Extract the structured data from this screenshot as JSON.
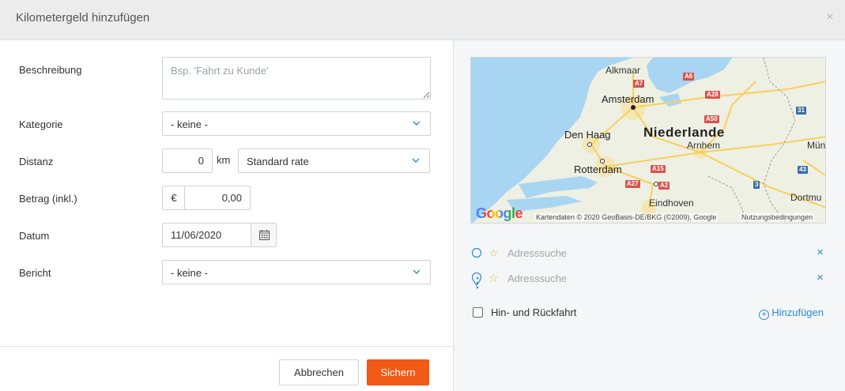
{
  "header": {
    "title": "Kilometergeld hinzufügen",
    "close_symbol": "×"
  },
  "form": {
    "description": {
      "label": "Beschreibung",
      "placeholder": "Bsp. 'Fahrt zu Kunde'",
      "value": ""
    },
    "category": {
      "label": "Kategorie",
      "value": "- keine -"
    },
    "distance": {
      "label": "Distanz",
      "value": "0",
      "unit": "km",
      "rate": "Standard rate"
    },
    "amount": {
      "label": "Betrag (inkl.)",
      "currency": "€",
      "value": "0,00"
    },
    "date": {
      "label": "Datum",
      "value": "11/06/2020"
    },
    "report": {
      "label": "Bericht",
      "value": "- keine -"
    }
  },
  "footer": {
    "cancel_label": "Abbrechen",
    "save_label": "Sichern"
  },
  "map": {
    "cities": {
      "alkmaar": "Alkmaar",
      "amsterdam": "Amsterdam",
      "den_haag": "Den Haag",
      "rotterdam": "Rotterdam",
      "arnhem": "Arnhem",
      "eindhoven": "Eindhoven",
      "munster": "Mün",
      "dortmund": "Dortmu"
    },
    "country": "Niederlande",
    "roads": {
      "a7": "A7",
      "a6": "A6",
      "a28": "A28",
      "a50": "A50",
      "a15": "A15",
      "a27": "A27",
      "a2": "A2",
      "r31": "31",
      "r43": "43",
      "r3": "3"
    },
    "logo": "Google",
    "attribution": "Kartendaten © 2020 GeoBasis-DE/BKG (©2009), Google",
    "terms": "Nutzungsbedingungen"
  },
  "route": {
    "start": {
      "placeholder": "Adresssuche",
      "remove_symbol": "×"
    },
    "end": {
      "placeholder": "Adresssuche",
      "remove_symbol": "×"
    },
    "round_trip_label": "Hin- und Rückfahrt",
    "add_label": "Hinzufügen",
    "add_symbol": "+"
  },
  "colors": {
    "accent": "#2a8bd1",
    "primary_button": "#f25a17",
    "water": "#a8d5f2",
    "land": "#eef0e4",
    "star": "#e8b73a"
  }
}
